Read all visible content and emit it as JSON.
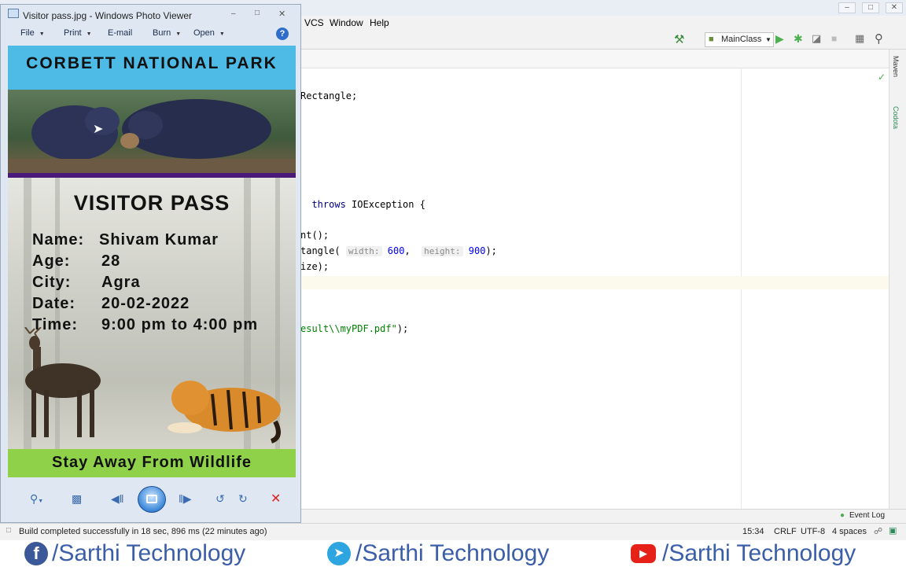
{
  "ide": {
    "menu": [
      "VCS",
      "Window",
      "Help"
    ],
    "run_config": "MainClass",
    "code_lines": [
      {
        "text": "Rectangle;"
      },
      {
        "pre": "throws",
        "text": " IOException {"
      },
      {
        "text": "nt();"
      },
      {
        "pre": "tangle(",
        "hint1": "width:",
        "num1": "600",
        "mid": ",  ",
        "hint2": "height:",
        "num2": "900",
        "post": ");"
      },
      {
        "text": "ize);"
      },
      {
        "pre": "esult\\\\myPDF.pdf\"",
        "text": ");"
      }
    ],
    "right_tabs": [
      "Maven",
      "Codota"
    ],
    "event_log": "Event Log",
    "status": {
      "message": "Build completed successfully in 18 sec, 896 ms (22 minutes ago)",
      "position": "15:34",
      "line_sep": "CRLF",
      "encoding": "UTF-8",
      "indent": "4 spaces"
    }
  },
  "viewer": {
    "title": "Visitor pass.jpg - Windows Photo Viewer",
    "menu": {
      "file": "File",
      "print": "Print",
      "email": "E-mail",
      "burn": "Burn",
      "open": "Open"
    },
    "help": "?"
  },
  "pass": {
    "park_name": "CORBETT NATIONAL PARK",
    "heading": "VISITOR PASS",
    "fields": [
      {
        "label": "Name:",
        "value": "Shivam Kumar"
      },
      {
        "label": "Age:",
        "value": "28"
      },
      {
        "label": "City:",
        "value": "Agra"
      },
      {
        "label": "Date:",
        "value": "20-02-2022"
      },
      {
        "label": "Time:",
        "value": "9:00 pm to 4:00 pm"
      }
    ],
    "footer": "Stay Away From Wildlife"
  },
  "social": {
    "facebook": "/Sarthi Technology",
    "telegram": "/Sarthi Technology",
    "youtube": "/Sarthi Technology"
  },
  "colors": {
    "pass_header": "#4dbbe6",
    "pass_footer": "#8fd24a",
    "facebook": "#3b5998",
    "telegram": "#2ca5e0",
    "youtube": "#e62117"
  }
}
